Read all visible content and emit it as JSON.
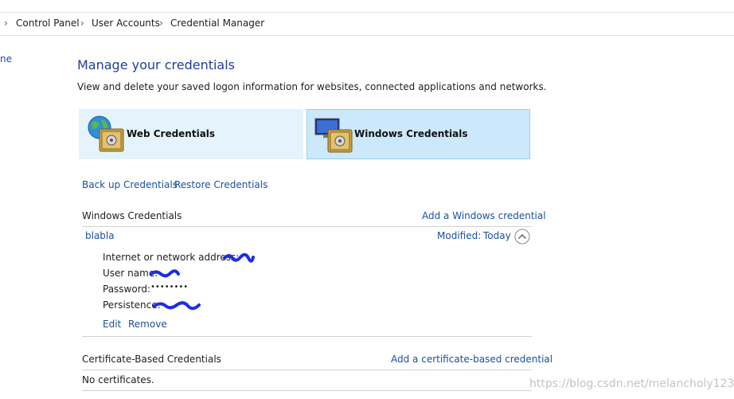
{
  "breadcrumb": {
    "items": [
      "Control Panel",
      "User Accounts",
      "Credential Manager"
    ]
  },
  "left_nav": {
    "partial_label": "ne"
  },
  "page": {
    "title": "Manage your credentials",
    "subtitle": "View and delete your saved logon information for websites, connected applications and networks."
  },
  "tiles": {
    "web": {
      "label": "Web Credentials",
      "icon": "globe-vault-icon"
    },
    "windows": {
      "label": "Windows Credentials",
      "icon": "monitor-vault-icon",
      "selected": true
    }
  },
  "actions": {
    "backup": "Back up Credentials",
    "restore": "Restore Credentials"
  },
  "windows_section": {
    "title": "Windows Credentials",
    "add_link": "Add a Windows credential",
    "entry": {
      "name": "blabla",
      "modified_label": "Modified:",
      "modified_value": "Today",
      "address_label": "Internet or network address:",
      "username_label": "User name:",
      "password_label": "Password:",
      "password_value": "••••••••",
      "persistence_label": "Persistence:",
      "edit": "Edit",
      "remove": "Remove"
    }
  },
  "cert_section": {
    "title": "Certificate-Based Credentials",
    "add_link": "Add a certificate-based credential",
    "empty_text": "No certificates."
  },
  "watermark": "https://blog.csdn.net/melancholy123",
  "colors": {
    "link": "#1b4fa1",
    "title": "#1e3f9e",
    "tile_selected": "#cce8fb",
    "tile": "#e5f3fd",
    "scribble": "#1a2fe0"
  }
}
